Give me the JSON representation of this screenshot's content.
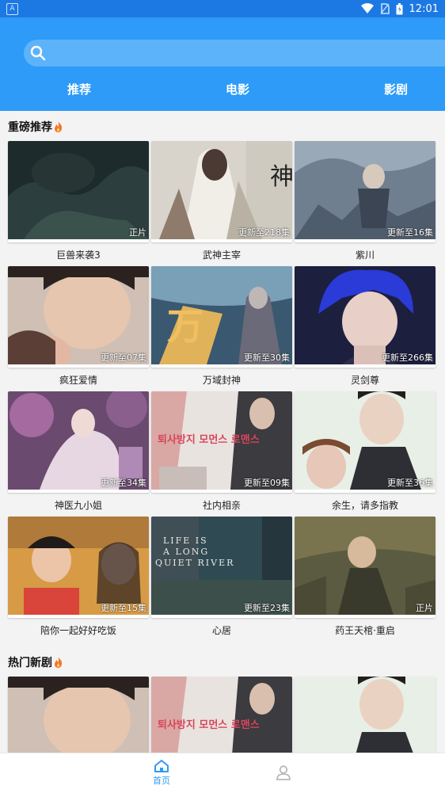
{
  "status_bar": {
    "left_badge": "A",
    "time": "12:01"
  },
  "search": {
    "placeholder": ""
  },
  "tabs": [
    {
      "label": "推荐"
    },
    {
      "label": "电影"
    },
    {
      "label": "影剧"
    }
  ],
  "sections": [
    {
      "title": "重磅推荐",
      "items": [
        {
          "title": "巨兽来袭3",
          "badge": "正片"
        },
        {
          "title": "武神主宰",
          "badge": "更新至218集"
        },
        {
          "title": "紫川",
          "badge": "更新至16集"
        },
        {
          "title": "疯狂爱情",
          "badge": "更新至07集"
        },
        {
          "title": "万域封神",
          "badge": "更新至30集"
        },
        {
          "title": "灵剑尊",
          "badge": "更新至266集"
        },
        {
          "title": "神医九小姐",
          "badge": "更新至34集"
        },
        {
          "title": "社内相亲",
          "badge": "更新至09集"
        },
        {
          "title": "余生，请多指教",
          "badge": "更新至36集"
        },
        {
          "title": "陪你一起好好吃饭",
          "badge": "更新至15集"
        },
        {
          "title": "心居",
          "badge": "更新至23集"
        },
        {
          "title": "药王天棺·重启",
          "badge": "正片"
        }
      ]
    },
    {
      "title": "热门新剧",
      "items": [
        {
          "title": "",
          "badge": ""
        },
        {
          "title": "",
          "badge": ""
        },
        {
          "title": "",
          "badge": ""
        }
      ]
    }
  ],
  "posters": {
    "p2_text": "神",
    "p5_text": "万",
    "p8_text": "퇴사방지 모먼스 로맨스",
    "p11_line1": "LIFE IS",
    "p11_line2": "A LONG",
    "p11_line3": "QUIET RIVER"
  },
  "bottom_nav": {
    "home_label": "首页",
    "profile_label": ""
  },
  "colors": {
    "header": "#2d9bf7",
    "status_bar": "#1c79e3",
    "active_nav": "#2d9bf7"
  }
}
